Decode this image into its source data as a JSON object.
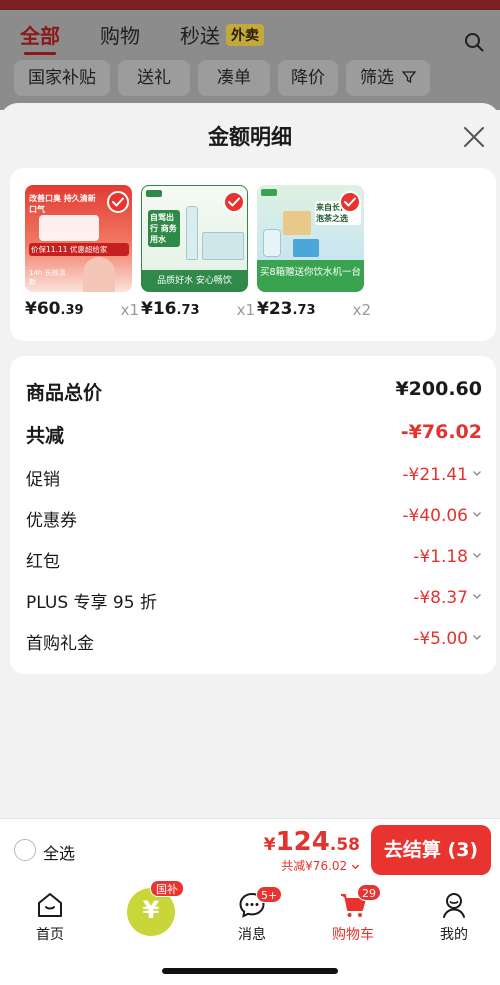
{
  "background": {
    "tabs": [
      "全部",
      "购物",
      "秒送"
    ],
    "waimai_badge": "外卖",
    "chips": [
      "国家补贴",
      "送礼",
      "凑单",
      "降价",
      "筛选"
    ]
  },
  "sheet": {
    "title": "金额明细",
    "products": [
      {
        "thumb_text": "改善口臭 持久清新口气",
        "promo_text": "价保11.11 优惠超给家",
        "extra_text": "14h 长效清新",
        "price_int": "¥60",
        "price_dec": ".39",
        "qty": "x1",
        "theme": "#d9322c"
      },
      {
        "thumb_text": "自驾出行 商务用水",
        "promo_text": "品质好水 安心畅饮",
        "extra_text": "",
        "price_int": "¥16",
        "price_dec": ".73",
        "qty": "x1",
        "theme": "#2f8a4a"
      },
      {
        "thumb_text": "来自长白山 泡茶之选",
        "promo_text": "买8箱赠送你饮水机一台",
        "extra_text": "",
        "price_int": "¥23",
        "price_dec": ".73",
        "qty": "x2",
        "theme": "#3aa34f"
      }
    ],
    "summary": {
      "total_label": "商品总价",
      "total_value": "¥200.60",
      "reduce_label": "共减",
      "reduce_value": "-¥76.02",
      "items": [
        {
          "label": "促销",
          "value": "-¥21.41"
        },
        {
          "label": "优惠券",
          "value": "-¥40.06"
        },
        {
          "label": "红包",
          "value": "-¥1.18"
        },
        {
          "label": "PLUS 专享 95 折",
          "value": "-¥8.37"
        },
        {
          "label": "首购礼金",
          "value": "-¥5.00"
        }
      ]
    }
  },
  "checkout": {
    "select_all": "全选",
    "yen": "¥",
    "total_int": "124",
    "total_dec": ".58",
    "discount_text": "共减¥76.02",
    "pay_label": "去结算 (3)"
  },
  "tabbar": {
    "items": [
      {
        "label": "首页",
        "icon": "home-icon"
      },
      {
        "label": "国补",
        "icon": "subsidy-icon"
      },
      {
        "label": "消息",
        "icon": "message-icon",
        "badge": "5+"
      },
      {
        "label": "购物车",
        "icon": "cart-icon",
        "badge": "29"
      },
      {
        "label": "我的",
        "icon": "profile-icon"
      }
    ],
    "guobu_badge": "国补"
  },
  "colors": {
    "accent": "#e8332e",
    "text": "#1a1a1a",
    "muted": "#999999"
  }
}
